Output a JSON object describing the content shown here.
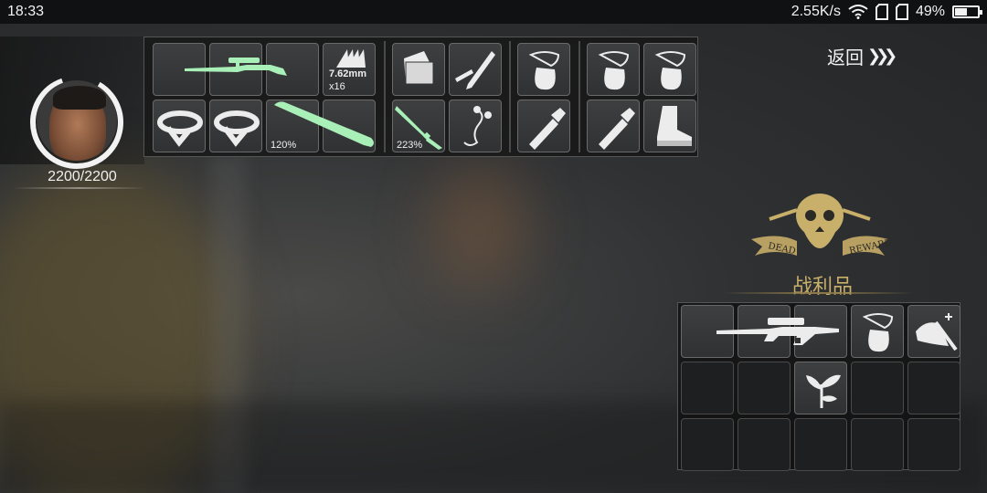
{
  "status_bar": {
    "time": "18:33",
    "net_speed": "2.55K/s",
    "battery_pct": "49%"
  },
  "character": {
    "hp_text": "2200/2200"
  },
  "inventory": {
    "ammo_label": "7.62mm",
    "ammo_count": "x16",
    "bat_durability": "120%",
    "knife_durability": "223%"
  },
  "nav": {
    "return_label": "返回"
  },
  "loot": {
    "title": "战利品",
    "emblem_left_text": "DEAD",
    "emblem_right_text": "REWARD"
  },
  "colors": {
    "weapon_accent": "#a8f0b8",
    "gold": "#c9b06a",
    "slot_bg": "#37393b"
  },
  "icons": [
    "sniper-rifle-icon",
    "ammo-icon",
    "wallet-icon",
    "pen-icon",
    "pouch-icon",
    "bandage-icon",
    "baseball-bat-icon",
    "knife-icon",
    "earphones-icon",
    "flashlight-icon",
    "boot-icon",
    "axe-icon",
    "herb-icon",
    "skull-emblem-icon"
  ]
}
